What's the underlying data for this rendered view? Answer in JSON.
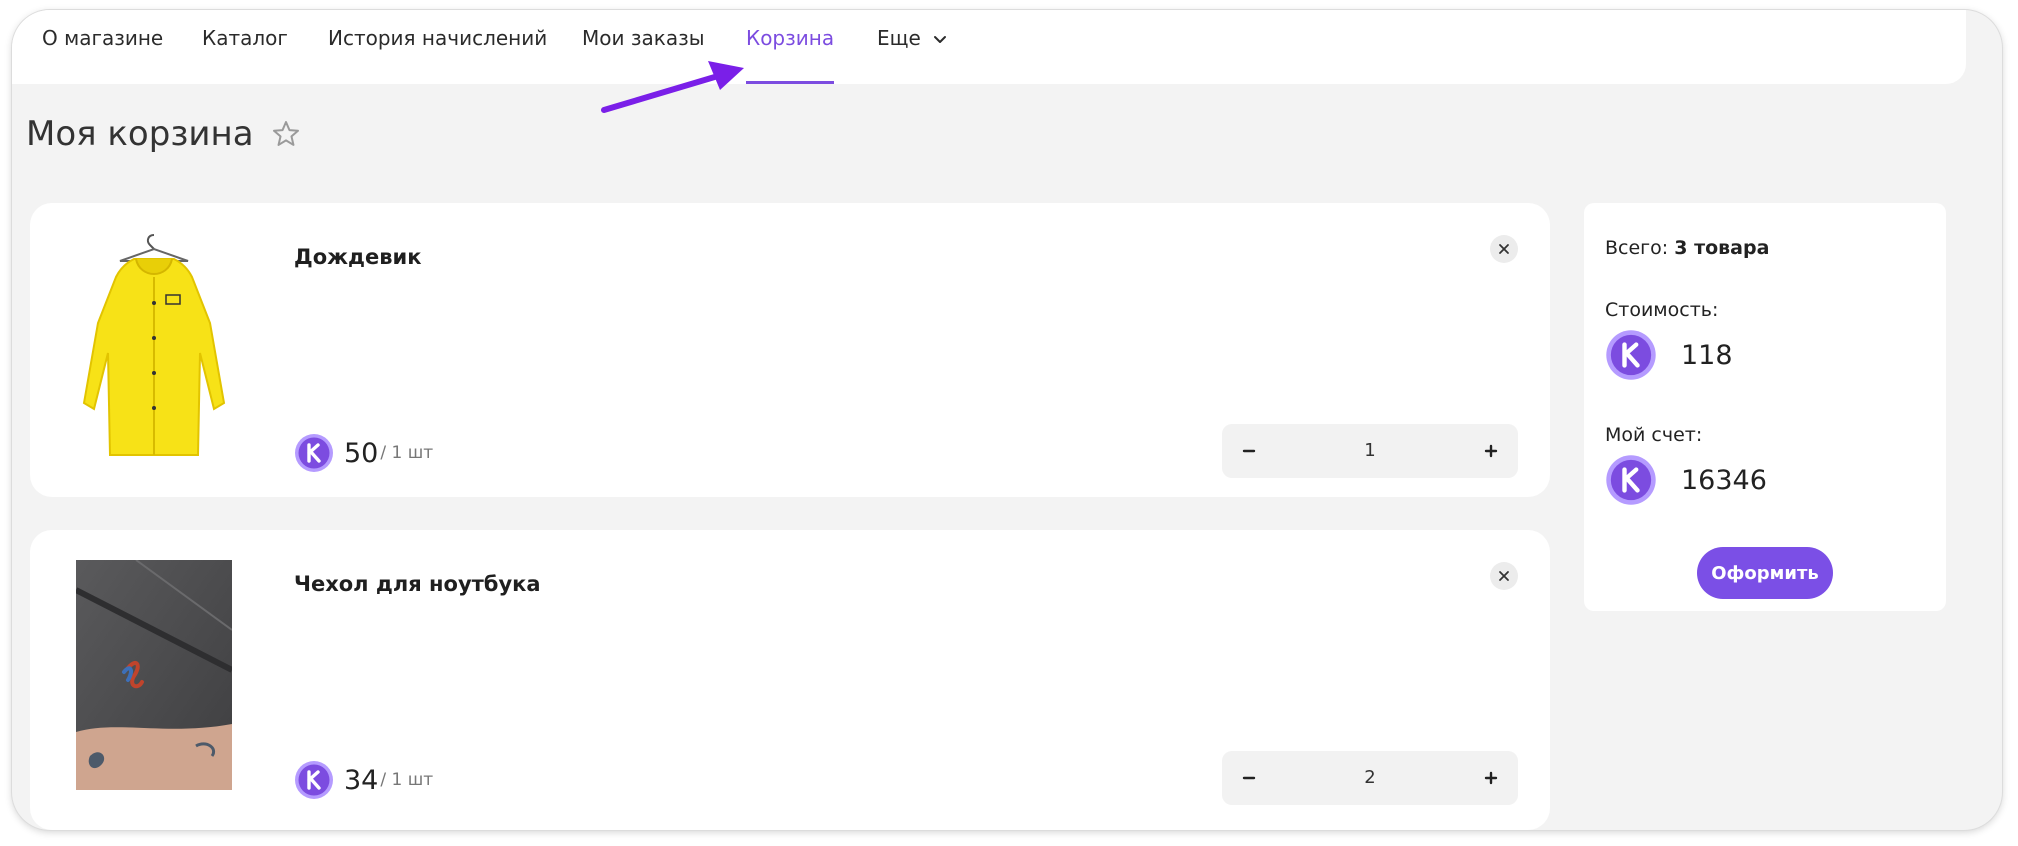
{
  "nav": {
    "items": [
      {
        "label": "О магазине"
      },
      {
        "label": "Каталог"
      },
      {
        "label": "История начислений"
      },
      {
        "label": "Мои заказы"
      },
      {
        "label": "Корзина"
      },
      {
        "label": "Еще"
      }
    ],
    "active_label": "Корзина"
  },
  "page": {
    "title": "Моя корзина"
  },
  "cart": {
    "items": [
      {
        "title": "Дождевик",
        "price": "50",
        "unit": "/ 1 шт",
        "quantity": "1",
        "image_icon": "raincoat-image"
      },
      {
        "title": "Чехол для ноутбука",
        "price": "34",
        "unit": "/ 1 шт",
        "quantity": "2",
        "image_icon": "laptop-sleeve-image"
      }
    ]
  },
  "summary": {
    "total_label": "Всего:",
    "total_value": "3 товара",
    "cost_label": "Стоимость:",
    "cost_value": "118",
    "account_label": "Мой счет:",
    "account_value": "16346",
    "checkout_label": "Оформить"
  },
  "colors": {
    "accent": "#7c4ce0",
    "button": "#7b4fe6",
    "background": "#f3f3f3",
    "card": "#ffffff"
  },
  "icons": {
    "coin": "k-coin-icon",
    "favorite": "star-outline-icon",
    "remove": "close-icon",
    "dropdown": "chevron-down-icon"
  }
}
